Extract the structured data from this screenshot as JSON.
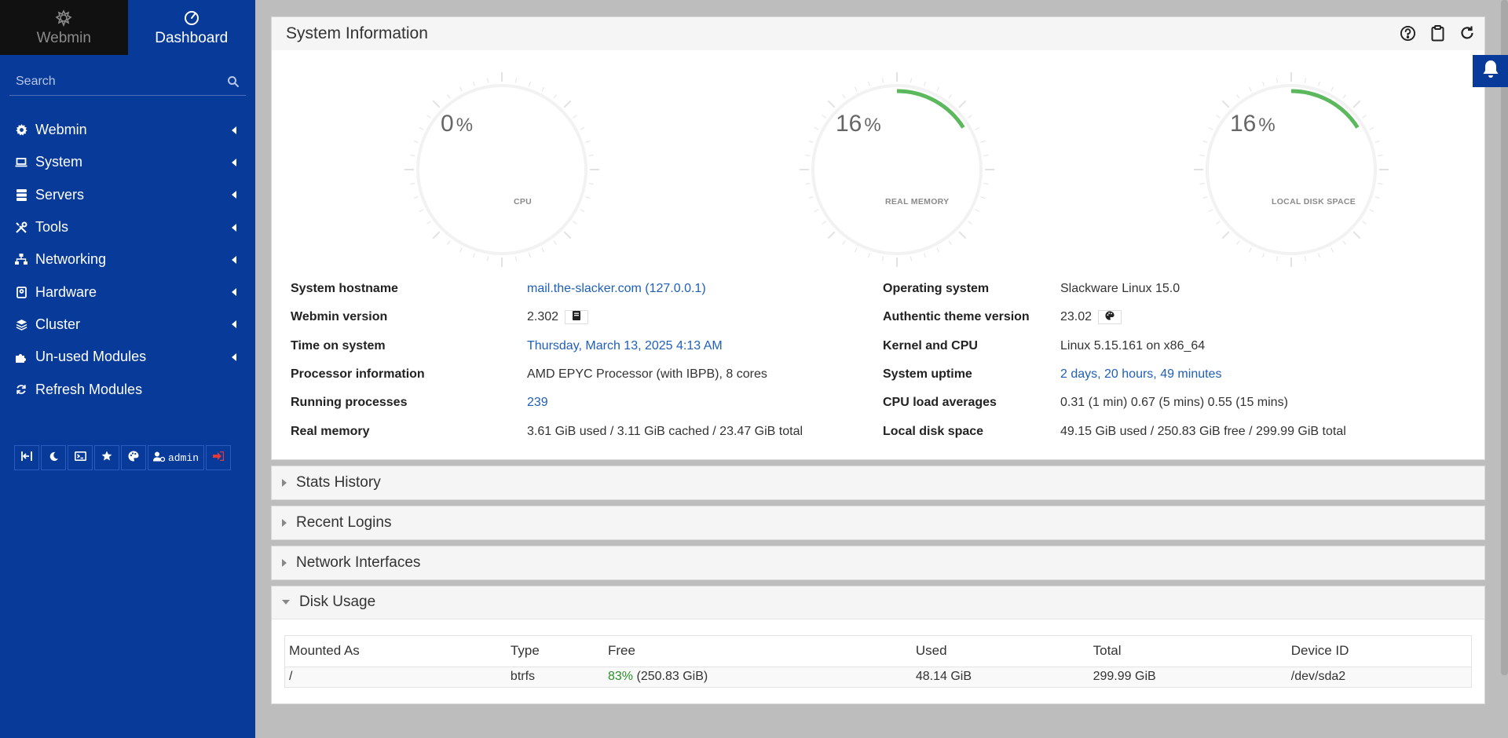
{
  "sidebar": {
    "tabs": [
      {
        "label": "Webmin",
        "icon": "webmin-logo-icon"
      },
      {
        "label": "Dashboard",
        "icon": "dashboard-gauge-icon"
      }
    ],
    "search_placeholder": "Search",
    "items": [
      {
        "label": "Webmin",
        "icon": "gear-icon"
      },
      {
        "label": "System",
        "icon": "laptop-icon"
      },
      {
        "label": "Servers",
        "icon": "server-icon"
      },
      {
        "label": "Tools",
        "icon": "tools-icon"
      },
      {
        "label": "Networking",
        "icon": "network-icon"
      },
      {
        "label": "Hardware",
        "icon": "hdd-icon"
      },
      {
        "label": "Cluster",
        "icon": "layers-icon"
      },
      {
        "label": "Un-used Modules",
        "icon": "puzzle-icon"
      },
      {
        "label": "Refresh Modules",
        "icon": "refresh-icon"
      }
    ],
    "bottom_user": "admin"
  },
  "system_info": {
    "title": "System Information",
    "gauges": [
      {
        "value": "0",
        "unit": "%",
        "label": "CPU",
        "fraction": 0.0
      },
      {
        "value": "16",
        "unit": "%",
        "label": "REAL MEMORY",
        "fraction": 0.16
      },
      {
        "value": "16",
        "unit": "%",
        "label": "LOCAL DISK SPACE",
        "fraction": 0.16
      }
    ],
    "left": [
      {
        "label": "System hostname",
        "value": "mail.the-slacker.com (127.0.0.1)"
      },
      {
        "label": "Webmin version",
        "value": "2.302"
      },
      {
        "label": "Time on system",
        "value": "Thursday, March 13, 2025 4:13 AM"
      },
      {
        "label": "Processor information",
        "value": "AMD EPYC Processor (with IBPB), 8 cores"
      },
      {
        "label": "Running processes",
        "value": "239"
      },
      {
        "label": "Real memory",
        "value": "3.61 GiB used / 3.11 GiB cached / 23.47 GiB total"
      }
    ],
    "right": [
      {
        "label": "Operating system",
        "value": "Slackware Linux 15.0"
      },
      {
        "label": "Authentic theme version",
        "value": "23.02"
      },
      {
        "label": "Kernel and CPU",
        "value": "Linux 5.15.161 on x86_64"
      },
      {
        "label": "System uptime",
        "value": "2 days, 20 hours, 49 minutes"
      },
      {
        "label": "CPU load averages",
        "value": "0.31 (1 min) 0.67 (5 mins) 0.55 (15 mins)"
      },
      {
        "label": "Local disk space",
        "value": "49.15 GiB used / 250.83 GiB free / 299.99 GiB total"
      }
    ]
  },
  "sections": {
    "stats_history": "Stats History",
    "recent_logins": "Recent Logins",
    "network_interfaces": "Network Interfaces",
    "disk_usage": "Disk Usage"
  },
  "disk_table": {
    "headers": [
      "Mounted As",
      "Type",
      "Free",
      "Used",
      "Total",
      "Device ID"
    ],
    "rows": [
      {
        "mount": "/",
        "type": "btrfs",
        "free_pct": "83%",
        "free_amount": "(250.83 GiB)",
        "used": "48.14 GiB",
        "total": "299.99 GiB",
        "device": "/dev/sda2"
      }
    ]
  },
  "colors": {
    "sidebar": "#073a99",
    "gauge_fill": "#5cb85c",
    "link": "#1f5fb7"
  }
}
